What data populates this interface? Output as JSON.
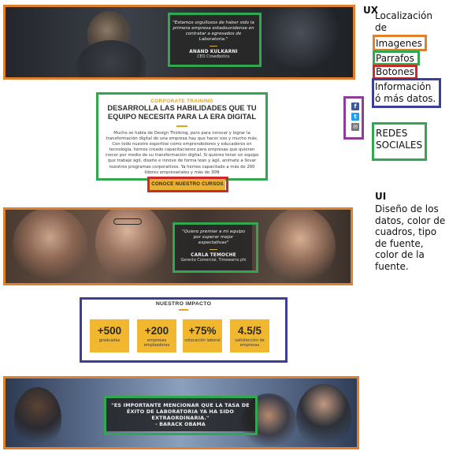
{
  "banner1": {
    "quote": "\"Estamos orgullosos de haber sido la primera empresa estadounidense en contratar a egresados de Laboratoria.\"",
    "name": "ANAND KULKARNI",
    "role": "CEO Crowdbotics"
  },
  "training": {
    "subtitle": "CORPORATE TRAINING",
    "title": "DESARROLLA LAS HABILIDADES QUE TU EQUIPO NECESITA PARA LA ERA DIGITAL",
    "body": "Mucho se habla de Design Thinking, pero para innovar y lograr la transformación digital de una empresa hay que hacer eso y mucho más. Con todo nuestro expertise como emprendedores y educadores en tecnología, hemos creado capacitaciones para empresas que quieran crecer por medio de su transformación digital. Si quieres tener un equipo que trabaje ágil, diseñe e innove de forma lean y ágil, animate a llevar nuestros programas corporativos. Ya hemos capacitado a más de 200 líderes empresariales y más de 30N",
    "cta": "CONOCE NUESTRO CURSOS"
  },
  "social": {
    "items": [
      {
        "icon": "facebook-icon",
        "glyph": "f",
        "color": "#3b5998"
      },
      {
        "icon": "twitter-icon",
        "glyph": "t",
        "color": "#1da1f2"
      },
      {
        "icon": "email-icon",
        "glyph": "✉",
        "color": "#777777"
      }
    ]
  },
  "banner2": {
    "quote": "\"Quiero premiar a mi equipo por superar mejor expectativas\"",
    "name": "CARLA TEMOCHE",
    "role": "Gerente Comercial, Timewarns phi"
  },
  "impact": {
    "title": "NUESTRO IMPACTO",
    "stats": [
      {
        "value": "+500",
        "label": "graduadas"
      },
      {
        "value": "+200",
        "label": "empresas empleadoras"
      },
      {
        "value": "+75%",
        "label": "colocación laboral"
      },
      {
        "value": "4.5/5",
        "label": "satisfacción de empresas"
      }
    ]
  },
  "banner3": {
    "quote": "\"ES IMPORTANTE MENCIONAR QUE LA TASA DE ÉXITO DE LABORATORIA YA HA SIDO EXTRAORDINARIA.\"",
    "author": "- BARACK OBAMA"
  },
  "annotations": {
    "ux_heading": "UX",
    "ux_intro": "Localización de",
    "ux_items": {
      "imagenes": "Imagenes",
      "parrafos": "Parrafos",
      "botones": "Botones",
      "info": "Información ó más datos."
    },
    "redes": "REDES SOCIALES",
    "ui_heading": "UI",
    "ui_text": "Diseño de los datos, color de cuadros, tipo de fuente, color de la fuente."
  },
  "colors": {
    "orange": "#e07f2c",
    "green": "#31a84f",
    "red": "#cc2b2b",
    "navy": "#3b3f95",
    "purple": "#8e3c97",
    "gold": "#f1b72f"
  }
}
